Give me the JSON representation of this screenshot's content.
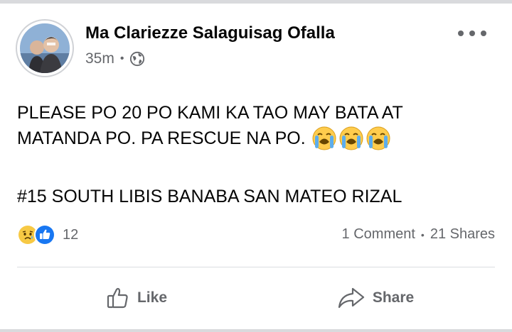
{
  "post": {
    "author": "Ma Clariezze Salaguisag Ofalla",
    "timestamp": "35m",
    "separator": "•",
    "privacy_icon": "globe-icon",
    "menu_icon": "more-options-icon",
    "lines": [
      "PLEASE PO 20 PO KAMI KA TAO MAY BATA AT",
      "MATANDA PO. PA RESCUE NA PO.",
      "#15 SOUTH LIBIS BANABA SAN MATEO RIZAL"
    ],
    "inline_emojis": [
      "loudly-crying-face",
      "loudly-crying-face",
      "loudly-crying-face"
    ]
  },
  "engagement": {
    "reaction_icons": [
      "sad-reaction",
      "like-reaction"
    ],
    "reaction_count": "12",
    "comments": "1 Comment",
    "separator": "•",
    "shares": "21 Shares"
  },
  "actions": {
    "like_label": "Like",
    "share_label": "Share"
  },
  "colors": {
    "primary_text": "#050505",
    "secondary_text": "#65676b",
    "like_blue": "#1877f2",
    "emoji_yellow": "#ffcc4d",
    "divider": "#dadde1"
  }
}
